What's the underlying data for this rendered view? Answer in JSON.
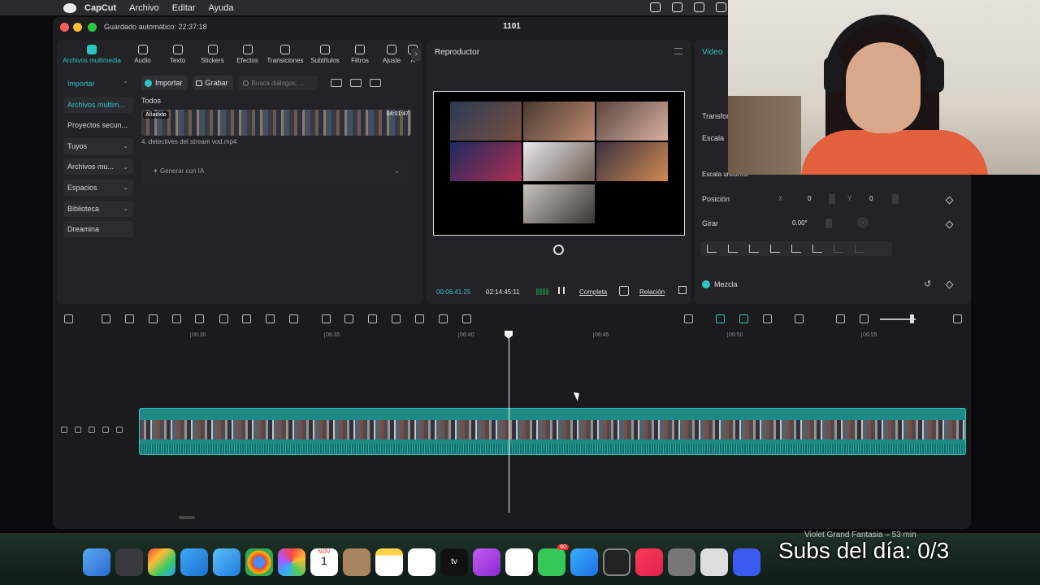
{
  "menubar": {
    "app": "CapCut",
    "items": [
      "Archivo",
      "Editar",
      "Ayuda"
    ]
  },
  "window": {
    "autosave": "Guardado automático: 22:37:18",
    "project": "1101"
  },
  "media": {
    "tabs": [
      {
        "label": "Archivos multimedia",
        "icon": "media-icon"
      },
      {
        "label": "Audio",
        "icon": "audio-icon"
      },
      {
        "label": "Texto",
        "icon": "text-icon"
      },
      {
        "label": "Stickers",
        "icon": "sticker-icon"
      },
      {
        "label": "Efectos",
        "icon": "effects-icon"
      },
      {
        "label": "Transiciones",
        "icon": "transition-icon"
      },
      {
        "label": "Subtítulos",
        "icon": "subtitle-icon"
      },
      {
        "label": "Filtros",
        "icon": "filter-icon"
      },
      {
        "label": "Ajuste",
        "icon": "adjust-icon"
      },
      {
        "label": "A",
        "icon": "more-icon"
      }
    ],
    "nav": [
      {
        "label": "Importar",
        "style": "sel"
      },
      {
        "label": "Archivos multim...",
        "style": "active"
      },
      {
        "label": "Proyectos secun...",
        "style": "plain"
      },
      {
        "label": "Tuyos",
        "style": "box"
      },
      {
        "label": "Archivos mu...",
        "style": "box"
      },
      {
        "label": "Espacios",
        "style": "box"
      },
      {
        "label": "Biblioteca",
        "style": "box"
      },
      {
        "label": "Dreamina",
        "style": "box"
      }
    ],
    "import_label": "Importar",
    "record_label": "Grabar",
    "search_placeholder": "Busca diálogos, ...",
    "todos": "Todos",
    "clip": {
      "tag": "Añadido",
      "duration": "04:01:47",
      "filename": "4. detectives del stream vod.mp4"
    },
    "ai_label": "Generar con IA"
  },
  "player": {
    "title": "Reproductor",
    "timecode": "00:06:41:25",
    "duration": "02:14:45:11",
    "completa": "Completa",
    "relacion": "Relación"
  },
  "inspector": {
    "tab": "Video",
    "transform": "Transfor",
    "escala": "Escala",
    "escala_uniforme": "Escala uniforme",
    "posicion": "Posición",
    "x_label": "X",
    "x_value": "0",
    "y_label": "Y",
    "y_value": "0",
    "girar": "Girar",
    "rotation": "0.00°",
    "mezcla": "Mezcla"
  },
  "timeline": {
    "ticks": [
      "06:30",
      "06:35",
      "06:40",
      "06:45",
      "06:50",
      "06:55"
    ]
  },
  "dock": {
    "now_playing": "Violet Grand Fantasia – 53 min",
    "calendar_month": "NOV",
    "calendar_day": "1",
    "badge": "60"
  },
  "overlay": {
    "text": "Subs del día: 0/3"
  },
  "colors": {
    "accent": "#2ec4c4",
    "clip": "#1e8a86"
  }
}
